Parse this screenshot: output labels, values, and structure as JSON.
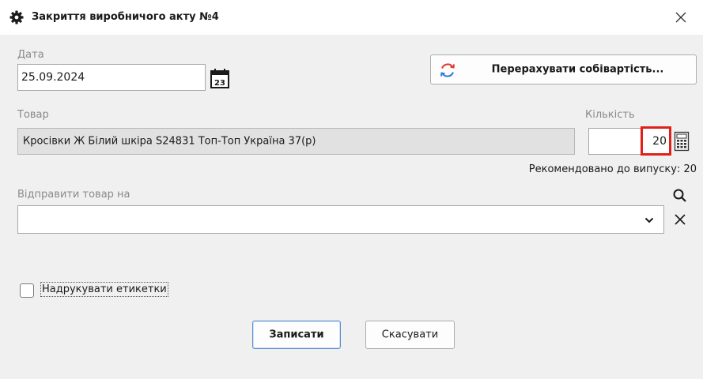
{
  "window": {
    "title": "Закриття виробничого акту №4"
  },
  "date": {
    "label": "Дата",
    "value": "25.09.2024",
    "calendar_day": "23"
  },
  "recalc_button": {
    "label": "Перерахувати собівартість..."
  },
  "product": {
    "label": "Товар",
    "value": "Кросівки Ж Білий шкіра S24831 Топ-Топ Україна 37(р)"
  },
  "quantity": {
    "label": "Кількість",
    "value": "20"
  },
  "recommended": {
    "text": "Рекомендовано до випуску: 20"
  },
  "send_to": {
    "label": "Відправити товар на",
    "value": ""
  },
  "print_labels": {
    "label": "Надрукувати етикетки",
    "checked": false
  },
  "buttons": {
    "save": "Записати",
    "cancel": "Скасувати"
  },
  "colors": {
    "highlight": "#e0201b",
    "recalc_red": "#e03a2f",
    "recalc_blue": "#2f7ad8"
  }
}
